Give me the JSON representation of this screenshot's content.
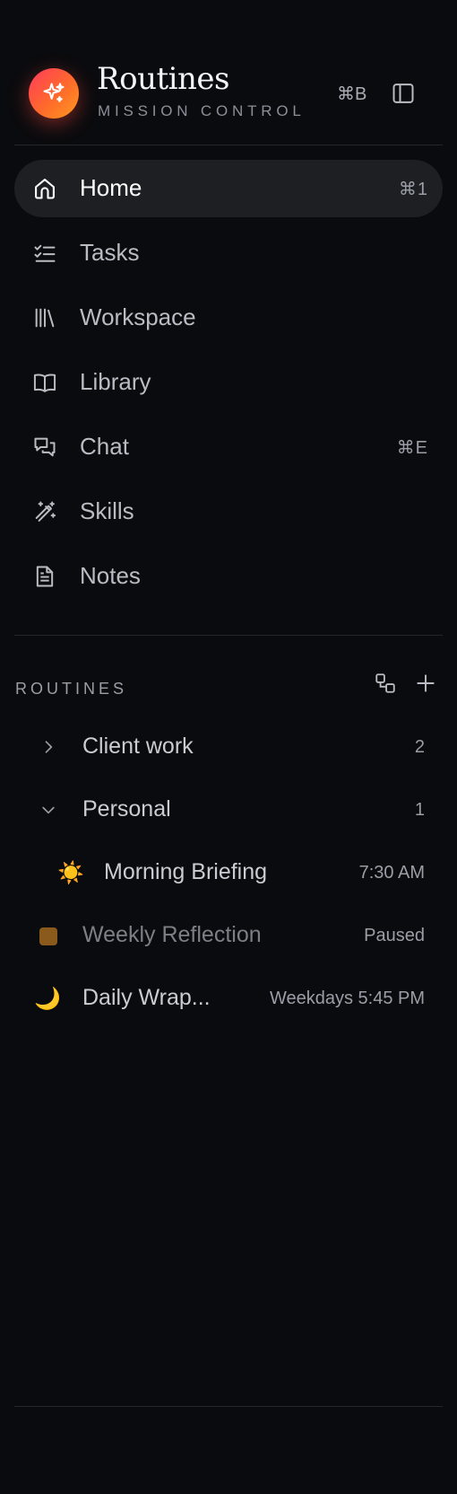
{
  "header": {
    "title": "Routines",
    "subtitle": "MISSION CONTROL",
    "shortcut": "⌘B",
    "accent_gradient": [
      "#ff3b5c",
      "#ff9a1f"
    ],
    "logo_icon": "sparkles-icon",
    "panel_icon": "sidebar-toggle-icon"
  },
  "nav": [
    {
      "label": "Home",
      "shortcut": "⌘1",
      "icon": "home-icon",
      "active": true
    },
    {
      "label": "Tasks",
      "shortcut": "",
      "icon": "checklist-icon",
      "active": false
    },
    {
      "label": "Workspace",
      "shortcut": "",
      "icon": "books-icon",
      "active": false
    },
    {
      "label": "Library",
      "shortcut": "",
      "icon": "book-open-icon",
      "active": false
    },
    {
      "label": "Chat",
      "shortcut": "⌘E",
      "icon": "chat-bubbles-icon",
      "active": false
    },
    {
      "label": "Skills",
      "shortcut": "",
      "icon": "magic-wand-icon",
      "active": false
    },
    {
      "label": "Notes",
      "shortcut": "",
      "icon": "document-icon",
      "active": false
    }
  ],
  "routines": {
    "section_title": "ROUTINES",
    "group_icon": "group-icon",
    "add_icon": "plus-icon",
    "groups": [
      {
        "label": "Client work",
        "count": "2",
        "expanded": false
      },
      {
        "label": "Personal",
        "count": "1",
        "expanded": true
      }
    ],
    "items": [
      {
        "emoji": "☀️",
        "label": "Morning Briefing",
        "schedule": "7:30 AM"
      },
      {
        "label": "Weekly Reflection",
        "schedule": "Paused",
        "status_color": "#8a5a1c"
      },
      {
        "emoji": "🌙",
        "label": "Daily Wrap...",
        "schedule": "Weekdays 5:45 PM"
      }
    ]
  }
}
